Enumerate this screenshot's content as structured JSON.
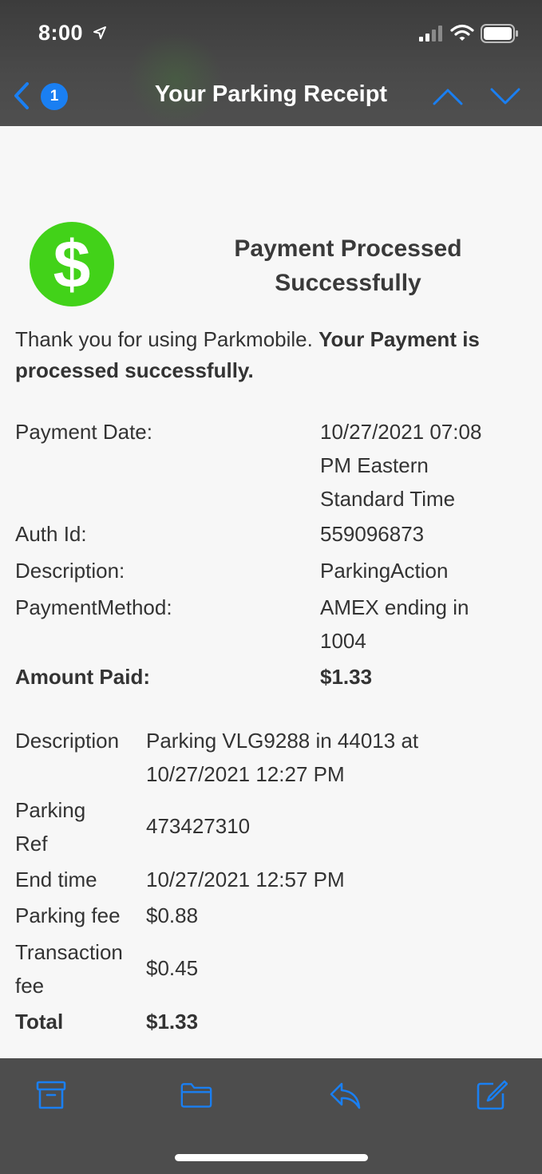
{
  "status_bar": {
    "time": "8:00"
  },
  "nav": {
    "unread_count": "1",
    "title": "Your Parking Receipt"
  },
  "receipt": {
    "icon_symbol": "$",
    "heading_line1": "Payment Processed",
    "heading_line2": "Successfully",
    "intro_plain": "Thank you for using Parkmobile. ",
    "intro_bold": "Your Payment is processed successfully.",
    "payment_date_label": "Payment Date:",
    "payment_date_line1": "10/27/2021 07:08",
    "payment_date_line2": "PM Eastern",
    "payment_date_line3": "Standard Time",
    "auth_id_label": "Auth Id:",
    "auth_id_value": "559096873",
    "description_label": "Description:",
    "description_value": "ParkingAction",
    "payment_method_label": "PaymentMethod:",
    "payment_method_line1": "AMEX ending in",
    "payment_method_line2": "1004",
    "amount_paid_label": "Amount Paid:",
    "amount_paid_value": "$1.33"
  },
  "details": {
    "description_label": "Description",
    "description_line1": "Parking VLG9288 in 44013 at",
    "description_line2": "10/27/2021 12:27 PM",
    "parking_ref_label_line1": "Parking",
    "parking_ref_label_line2": "Ref",
    "parking_ref_value": "473427310",
    "end_time_label": "End time",
    "end_time_value": "10/27/2021 12:57 PM",
    "parking_fee_label": "Parking fee",
    "parking_fee_value": "$0.88",
    "transaction_fee_label_line1": "Transaction",
    "transaction_fee_label_line2": "fee",
    "transaction_fee_value": "$0.45",
    "total_label": "Total",
    "total_value": "$1.33"
  },
  "colors": {
    "accent_blue": "#1a7ff2",
    "success_green": "#42d219",
    "bar_gray": "#4d4d4d"
  },
  "toolbar_icons": [
    "archive-icon",
    "folder-icon",
    "reply-icon",
    "compose-icon"
  ]
}
